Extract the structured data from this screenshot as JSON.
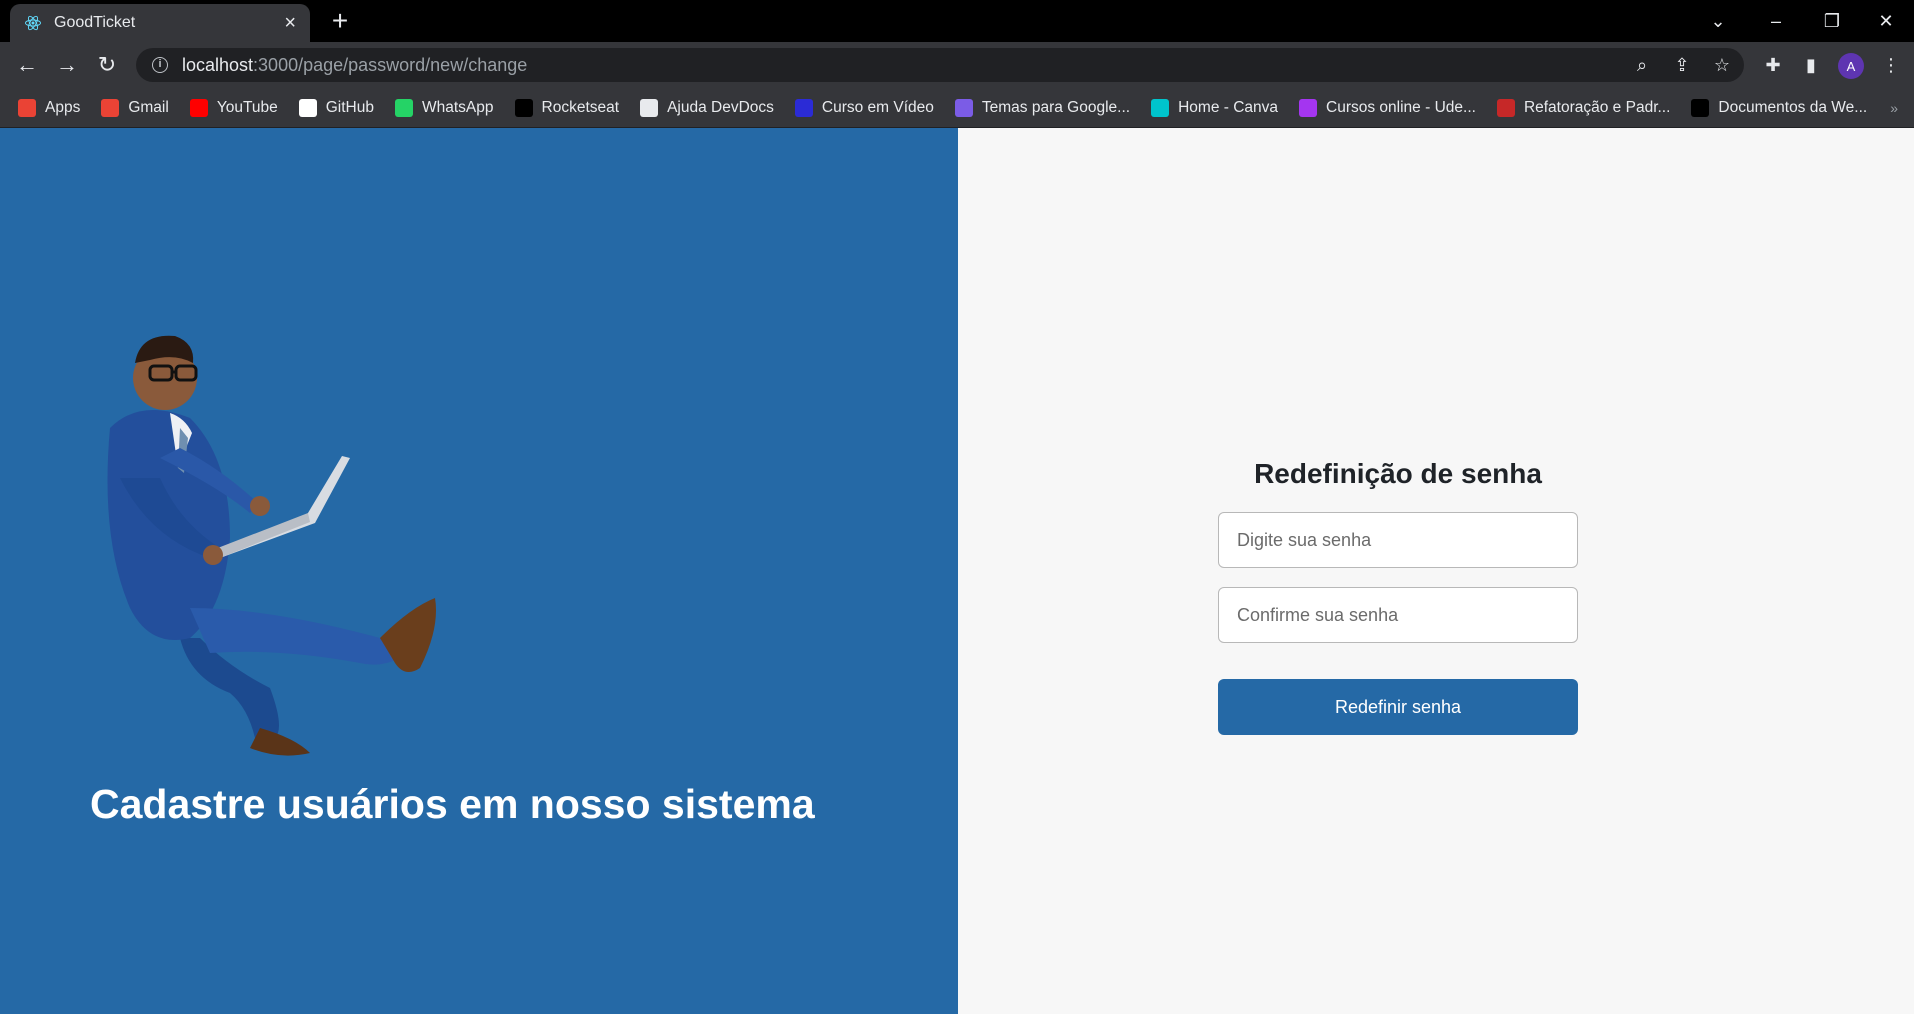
{
  "browser": {
    "tab_title": "GoodTicket",
    "url_host": "localhost",
    "url_rest": ":3000/page/password/new/change",
    "profile_initial": "A",
    "bookmarks": [
      {
        "label": "Apps",
        "icon": "apps-grid-icon",
        "color": "#ea4335"
      },
      {
        "label": "Gmail",
        "icon": "gmail-icon",
        "color": "#ea4335"
      },
      {
        "label": "YouTube",
        "icon": "youtube-icon",
        "color": "#ff0000"
      },
      {
        "label": "GitHub",
        "icon": "github-icon",
        "color": "#ffffff"
      },
      {
        "label": "WhatsApp",
        "icon": "whatsapp-icon",
        "color": "#25d366"
      },
      {
        "label": "Rocketseat",
        "icon": "rocketseat-icon",
        "color": "#000000"
      },
      {
        "label": "Ajuda DevDocs",
        "icon": "devdocs-icon",
        "color": "#e8eaed"
      },
      {
        "label": "Curso em Vídeo",
        "icon": "curso-em-video-icon",
        "color": "#2b2bd6"
      },
      {
        "label": "Temas para Google...",
        "icon": "temas-icon",
        "color": "#7b5ce6"
      },
      {
        "label": "Home - Canva",
        "icon": "canva-icon",
        "color": "#00c4cc"
      },
      {
        "label": "Cursos online - Ude...",
        "icon": "udemy-icon",
        "color": "#a435f0"
      },
      {
        "label": "Refatoração e Padr...",
        "icon": "refactoring-icon",
        "color": "#c62828"
      },
      {
        "label": "Documentos da We...",
        "icon": "mdn-icon",
        "color": "#000000"
      }
    ]
  },
  "hero": {
    "title": "Cadastre usuários em nosso sistema"
  },
  "form": {
    "title": "Redefinição de senha",
    "password_placeholder": "Digite sua senha",
    "confirm_placeholder": "Confirme sua senha",
    "submit_label": "Redefinir senha"
  },
  "colors": {
    "brand_blue": "#2569a6",
    "panel_bg": "#f7f7f7"
  }
}
